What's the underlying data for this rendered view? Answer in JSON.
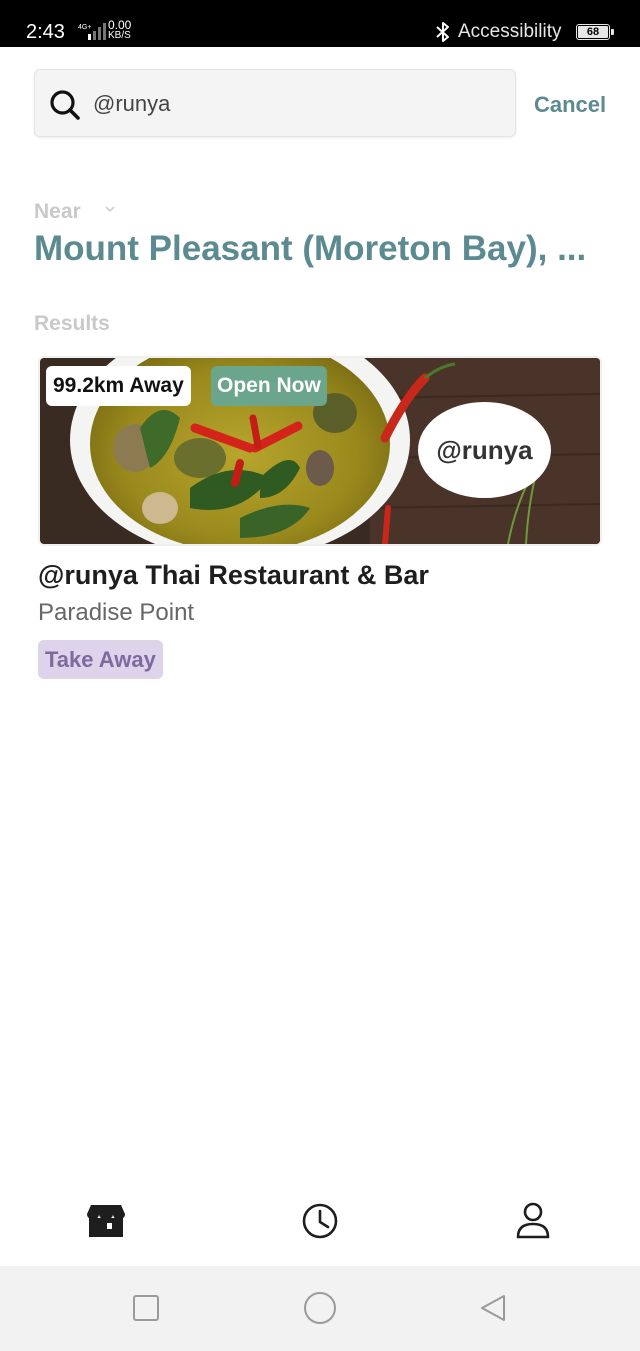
{
  "status_bar": {
    "time": "2:43",
    "network_type": "4G+",
    "data_rate": "0.00",
    "data_unit": "KB/S",
    "accessibility_label": "Accessibility",
    "battery": "68"
  },
  "search": {
    "query": "@runya",
    "cancel_label": "Cancel"
  },
  "location": {
    "near_label": "Near",
    "name": "Mount Pleasant (Moreton Bay), ..."
  },
  "results": {
    "label": "Results",
    "items": [
      {
        "distance": "99.2km Away",
        "status": "Open Now",
        "logo_text": "@runya",
        "name": "@runya Thai Restaurant & Bar",
        "area": "Paradise Point",
        "tag": "Take Away"
      }
    ]
  },
  "bottom_nav": {
    "items": [
      {
        "icon": "store-icon"
      },
      {
        "icon": "clock-icon"
      },
      {
        "icon": "user-icon"
      }
    ]
  },
  "colors": {
    "accent": "#5b8a91",
    "open_badge": "#6aa58c",
    "tag_bg": "#ddd3ea",
    "tag_text": "#7f6aa0"
  }
}
